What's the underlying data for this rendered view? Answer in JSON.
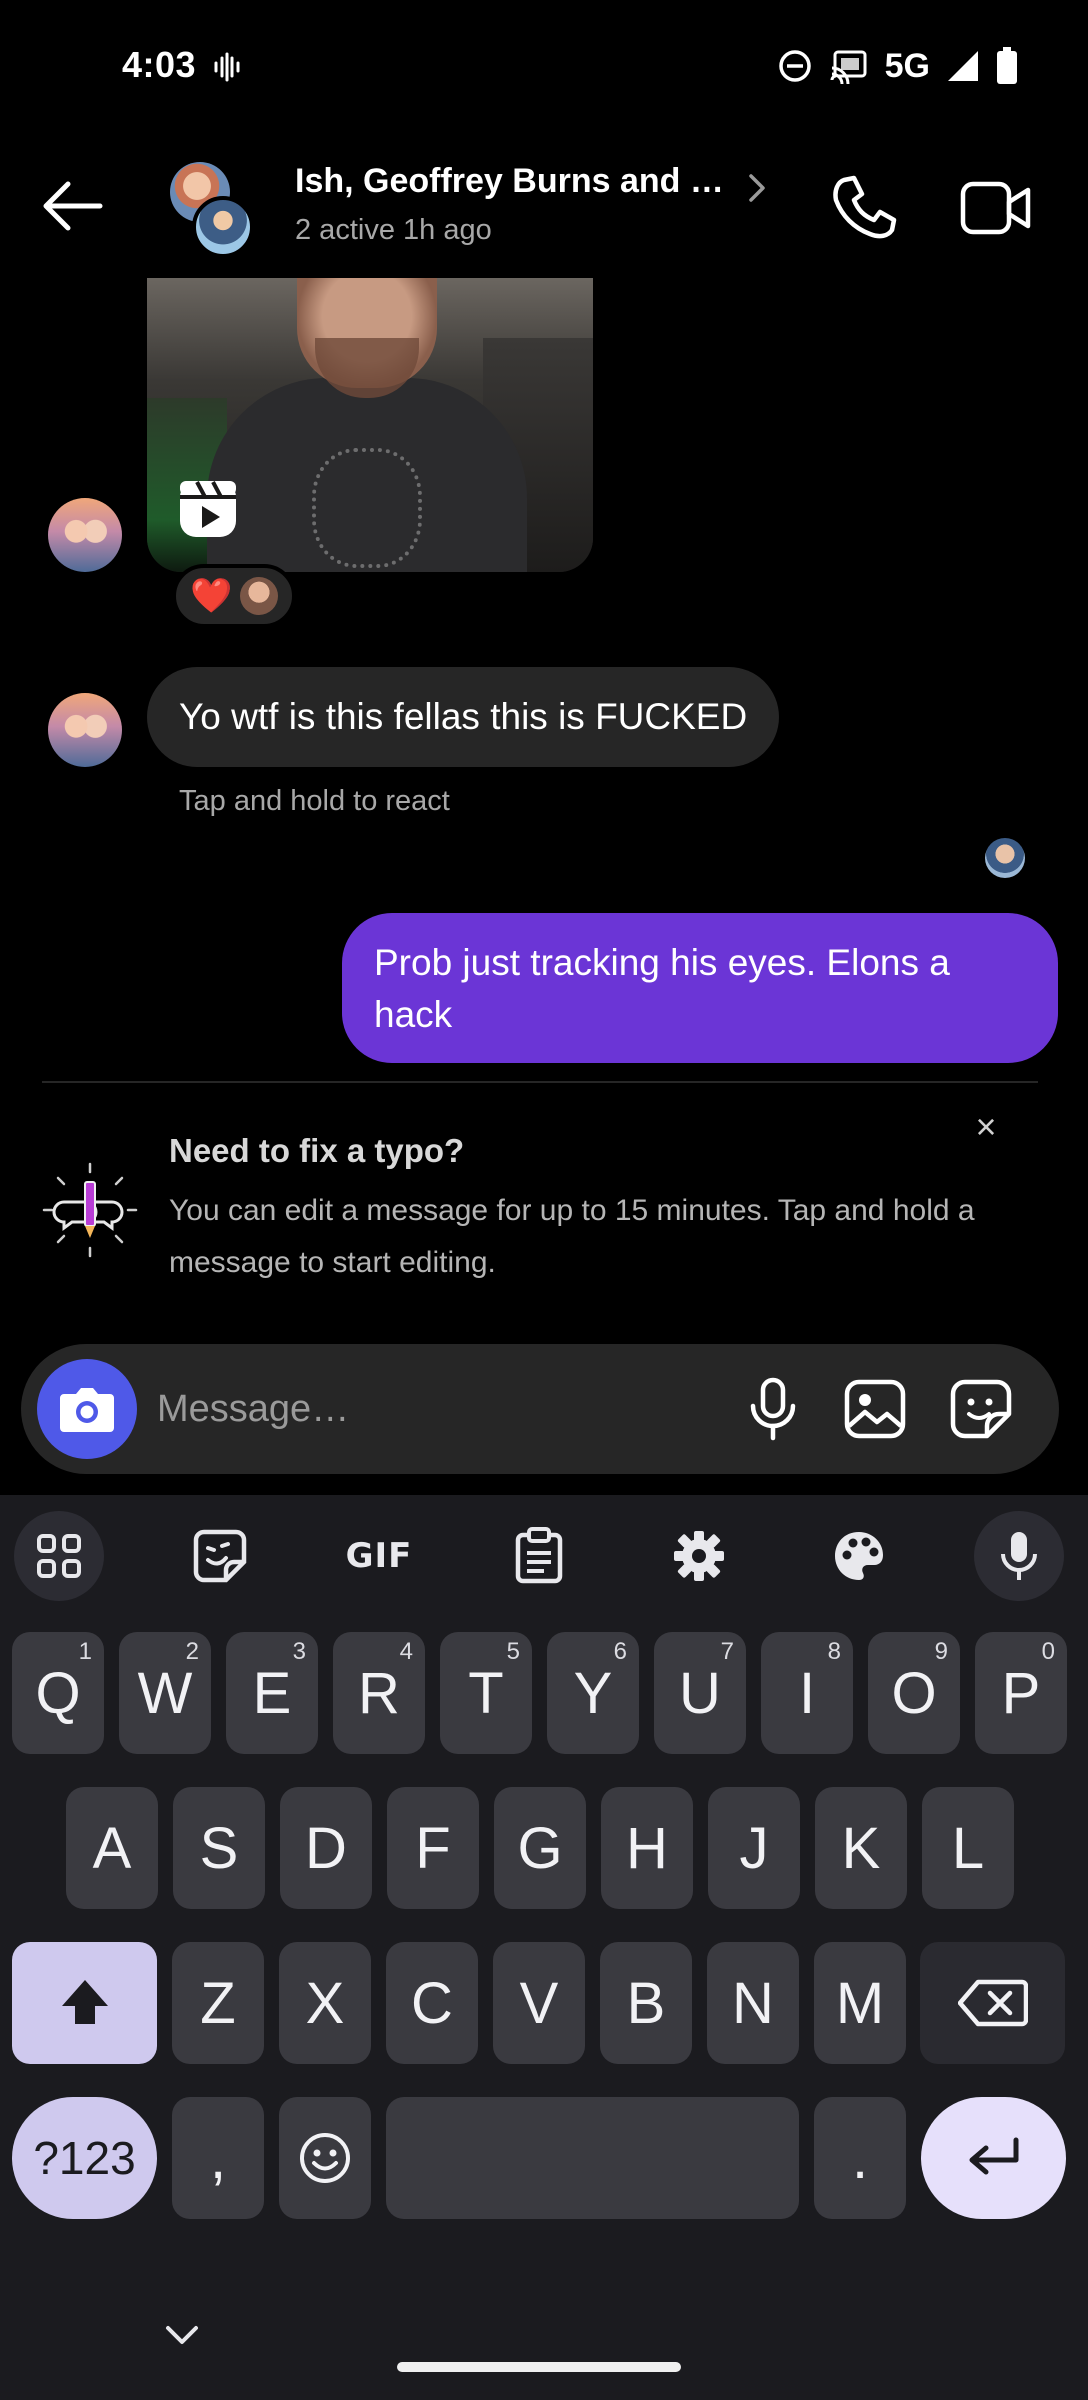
{
  "status_bar": {
    "time": "4:03",
    "network": "5G"
  },
  "header": {
    "title": "Ish, Geoffrey Burns and …",
    "subtitle": "2 active 1h ago"
  },
  "messages": {
    "reel_reactions": [
      "❤️"
    ],
    "incoming_text": "Yo wtf is this fellas this is FUCKED",
    "react_hint": "Tap and hold to react",
    "outgoing_text": "Prob just tracking his eyes. Elons a hack"
  },
  "tip": {
    "title": "Need to fix a typo?",
    "body": "You can edit a message for up to 15 minutes. Tap and hold a message to start editing.",
    "close": "×"
  },
  "composer": {
    "placeholder": "Message…"
  },
  "keyboard": {
    "toolbar": {
      "gif_label": "GIF"
    },
    "row1": [
      {
        "key": "Q",
        "hint": "1"
      },
      {
        "key": "W",
        "hint": "2"
      },
      {
        "key": "E",
        "hint": "3"
      },
      {
        "key": "R",
        "hint": "4"
      },
      {
        "key": "T",
        "hint": "5"
      },
      {
        "key": "Y",
        "hint": "6"
      },
      {
        "key": "U",
        "hint": "7"
      },
      {
        "key": "I",
        "hint": "8"
      },
      {
        "key": "O",
        "hint": "9"
      },
      {
        "key": "P",
        "hint": "0"
      }
    ],
    "row2": [
      "A",
      "S",
      "D",
      "F",
      "G",
      "H",
      "J",
      "K",
      "L"
    ],
    "row3": [
      "Z",
      "X",
      "C",
      "V",
      "B",
      "N",
      "M"
    ],
    "symbols_label": "?123",
    "comma": ",",
    "period": "."
  },
  "icons": {
    "status": [
      "vibrate-icon",
      "dnd-icon",
      "cast-icon",
      "signal-icon",
      "battery-icon"
    ],
    "header": [
      "back-arrow-icon",
      "chevron-right-icon",
      "phone-icon",
      "video-camera-icon"
    ],
    "composer": [
      "camera-icon",
      "microphone-icon",
      "gallery-icon",
      "sticker-icon"
    ],
    "keyboard_toolbar": [
      "apps-grid-icon",
      "sticker-icon",
      "clipboard-icon",
      "settings-gear-icon",
      "palette-icon",
      "microphone-icon"
    ]
  },
  "colors": {
    "outgoing_bubble": "#6b35d6",
    "incoming_bubble": "#262626",
    "camera_button": "#4f59e8",
    "heart": "#ff3040",
    "keyboard_bg": "#1b1b1f"
  }
}
